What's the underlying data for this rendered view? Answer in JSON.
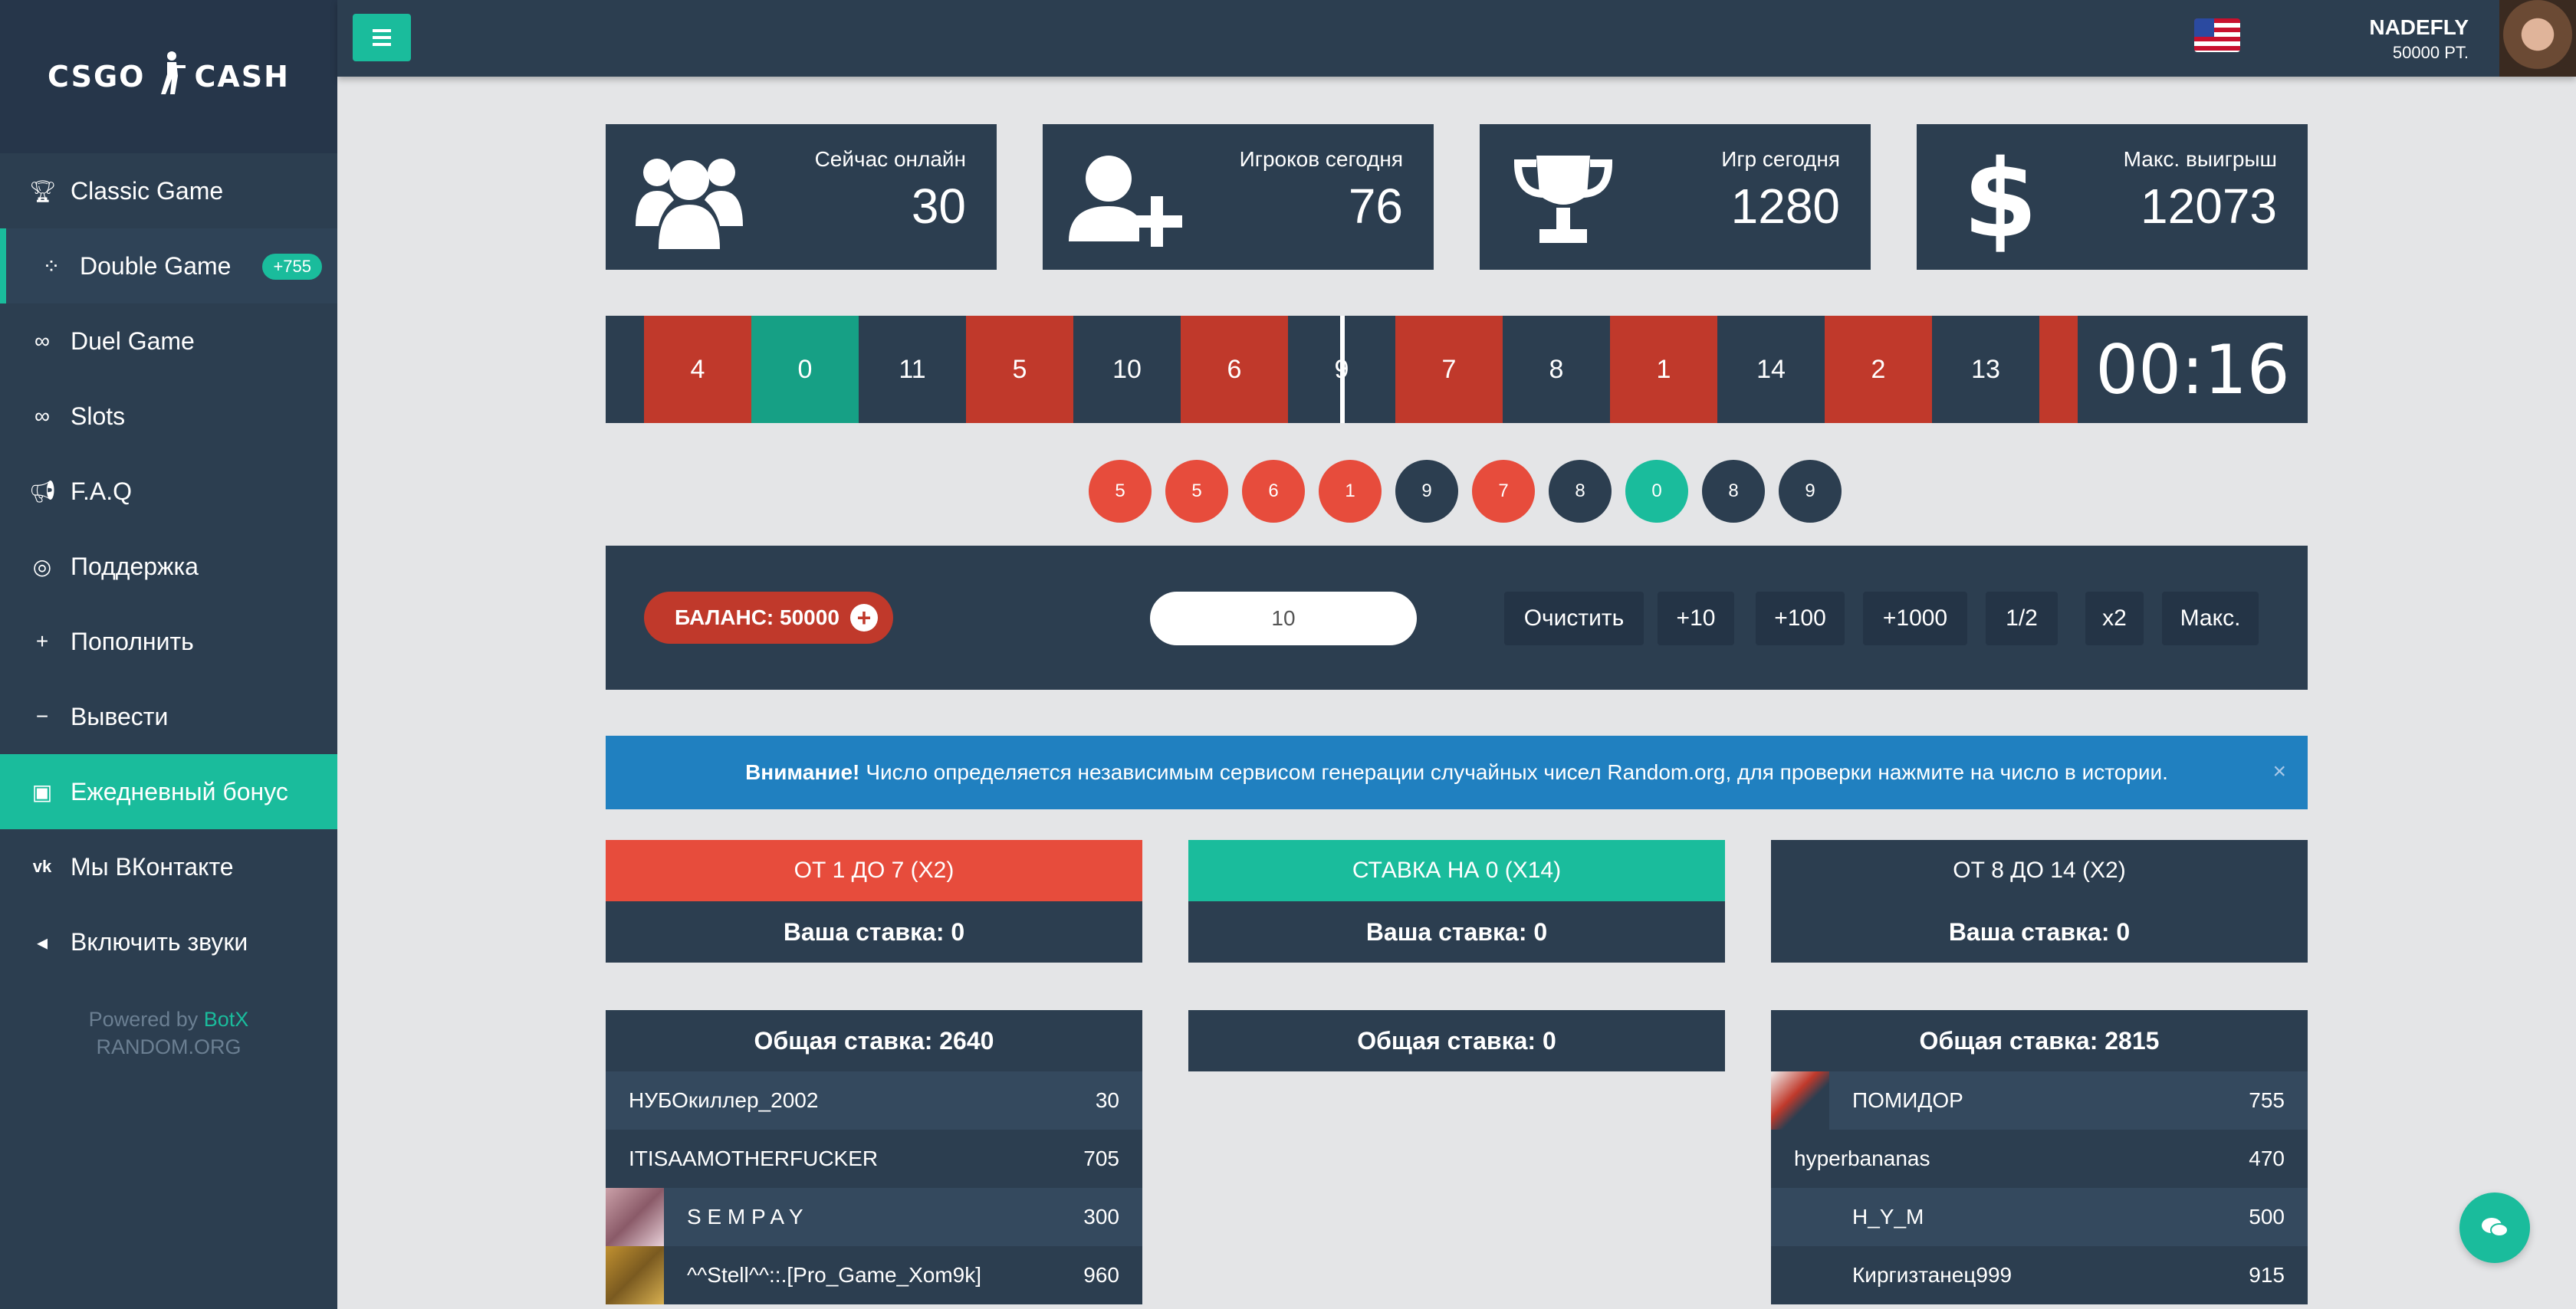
{
  "logo": {
    "left": "CSGO",
    "right": "CASH"
  },
  "sidebar": {
    "items": [
      {
        "label": "Classic Game",
        "icon": "trophy-icon"
      },
      {
        "label": "Double Game",
        "icon": "spinner-icon",
        "badge": "+755"
      },
      {
        "label": "Duel Game",
        "icon": "link-icon"
      },
      {
        "label": "Slots",
        "icon": "link-icon"
      },
      {
        "label": "F.A.Q",
        "icon": "bullhorn-icon"
      },
      {
        "label": "Поддержка",
        "icon": "lifebuoy-icon"
      },
      {
        "label": "Пополнить",
        "icon": "plus-icon"
      },
      {
        "label": "Вывести",
        "icon": "minus-icon"
      },
      {
        "label": "Ежедневный бонус",
        "icon": "gift-icon"
      },
      {
        "label": "Мы ВКонтакте",
        "icon": "vk-icon"
      },
      {
        "label": "Включить звуки",
        "icon": "volume-icon"
      }
    ],
    "powered_prefix": "Powered by",
    "powered_brand": "BotX",
    "random_org": "RANDOM.ORG"
  },
  "header": {
    "username": "NADEFLY",
    "points": "50000 PT."
  },
  "stats": [
    {
      "label": "Сейчас онлайн",
      "value": "30",
      "icon": "users-icon"
    },
    {
      "label": "Игроков сегодня",
      "value": "76",
      "icon": "user-plus-icon"
    },
    {
      "label": "Игр сегодня",
      "value": "1280",
      "icon": "trophy-icon"
    },
    {
      "label": "Макс. выигрыш",
      "value": "12073",
      "icon": "dollar-icon"
    }
  ],
  "roulette": {
    "cells": [
      {
        "n": "4",
        "c": "red"
      },
      {
        "n": "0",
        "c": "green"
      },
      {
        "n": "11",
        "c": "dark"
      },
      {
        "n": "5",
        "c": "red"
      },
      {
        "n": "10",
        "c": "dark"
      },
      {
        "n": "6",
        "c": "red"
      },
      {
        "n": "9",
        "c": "dark"
      },
      {
        "n": "7",
        "c": "red"
      },
      {
        "n": "8",
        "c": "dark"
      },
      {
        "n": "1",
        "c": "red"
      },
      {
        "n": "14",
        "c": "dark"
      },
      {
        "n": "2",
        "c": "red"
      },
      {
        "n": "13",
        "c": "dark"
      }
    ],
    "timer": "00:16"
  },
  "history": [
    {
      "n": "5",
      "c": "red"
    },
    {
      "n": "5",
      "c": "red"
    },
    {
      "n": "6",
      "c": "red"
    },
    {
      "n": "1",
      "c": "red"
    },
    {
      "n": "9",
      "c": "dark"
    },
    {
      "n": "7",
      "c": "red"
    },
    {
      "n": "8",
      "c": "dark"
    },
    {
      "n": "0",
      "c": "green"
    },
    {
      "n": "8",
      "c": "dark"
    },
    {
      "n": "9",
      "c": "dark"
    }
  ],
  "betbar": {
    "balance": "БАЛАНС: 50000",
    "input_value": "10",
    "buttons": [
      "Очистить",
      "+10",
      "+100",
      "+1000",
      "1/2",
      "x2",
      "Макс."
    ]
  },
  "notice": {
    "bold": "Внимание!",
    "text": "Число определяется независимым сервисом генерации случайных чисел Random.org, для проверки нажмите на число в истории.",
    "close": "×"
  },
  "bets": [
    {
      "header": "ОТ 1 ДО 7 (X2)",
      "color": "red",
      "your_bet": "Ваша ставка: 0",
      "total": "Общая ставка: 2640",
      "players": [
        {
          "name": "НУБОкиллер_2002",
          "value": "30",
          "av": "none"
        },
        {
          "name": "ITISAAMOTHERFUCKER",
          "value": "705",
          "av": "none"
        },
        {
          "name": "S E M P A Y",
          "value": "300",
          "av": "a"
        },
        {
          "name": "^^Stell^^::.[Pro_Game_Xom9k]",
          "value": "960",
          "av": "b"
        }
      ]
    },
    {
      "header": "СТАВКА НА 0 (X14)",
      "color": "green",
      "your_bet": "Ваша ставка: 0",
      "total": "Общая ставка: 0",
      "players": []
    },
    {
      "header": "ОТ 8 ДО 14 (X2)",
      "color": "dark",
      "your_bet": "Ваша ставка: 0",
      "total": "Общая ставка: 2815",
      "players": [
        {
          "name": "ПОМИДОР",
          "value": "755",
          "av": "c"
        },
        {
          "name": "hyperbananas",
          "value": "470",
          "av": "none"
        },
        {
          "name": "H_Y_M",
          "value": "500",
          "av": "blank"
        },
        {
          "name": "Киргизтанец999",
          "value": "915",
          "av": "blank"
        }
      ]
    }
  ],
  "colors": {
    "accent": "#1abc9c",
    "red": "#e74c3c",
    "panel": "#2c3e50",
    "notice": "#2080c0"
  }
}
